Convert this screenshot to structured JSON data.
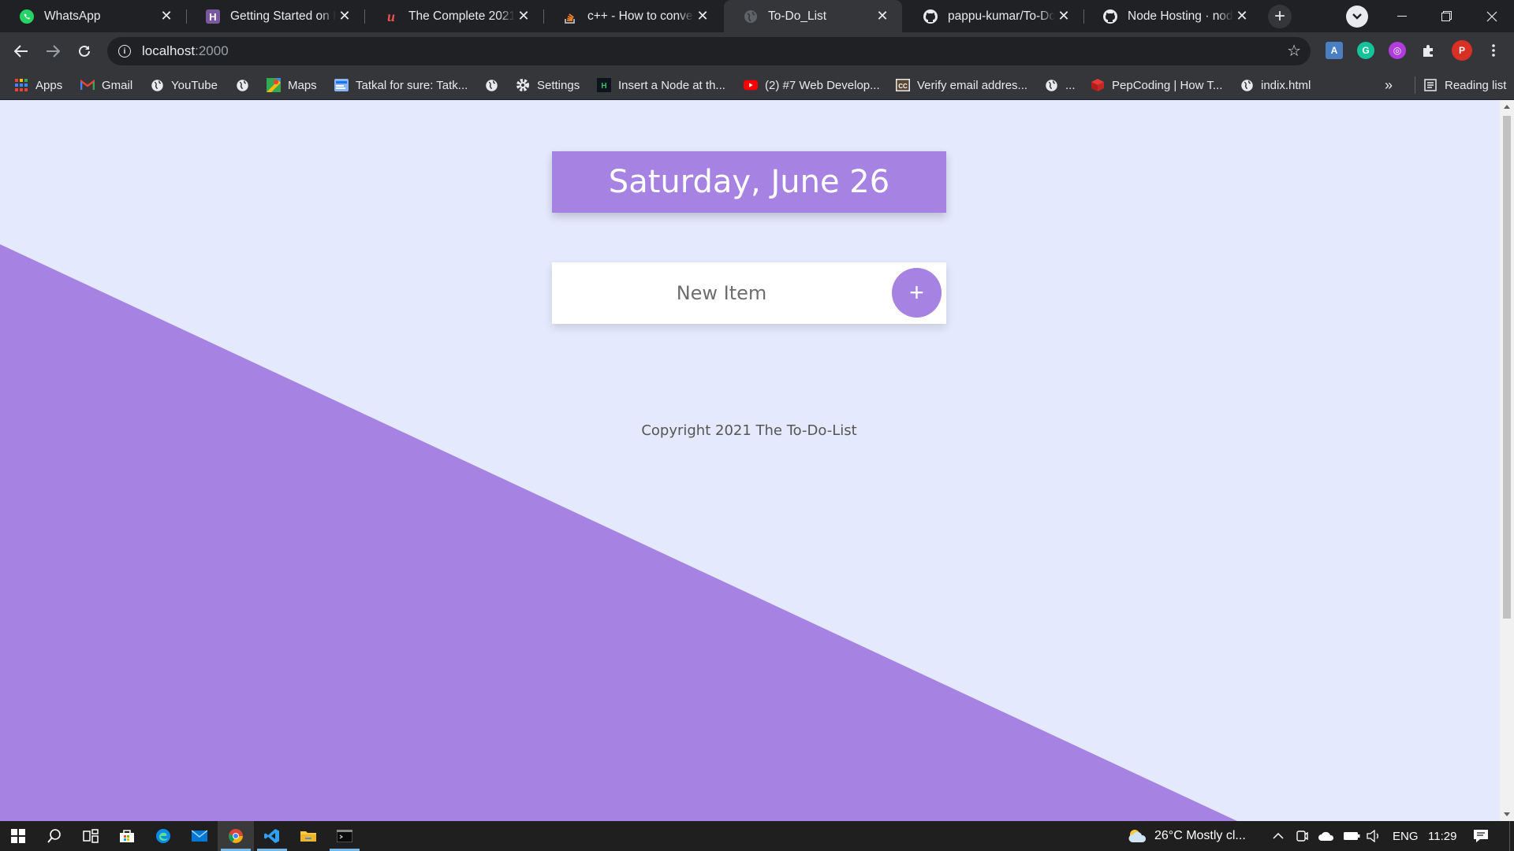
{
  "browser": {
    "tabs": [
      {
        "title": "WhatsApp",
        "icon": "whatsapp-icon",
        "active": false
      },
      {
        "title": "Getting Started on Heroku",
        "icon": "heroku-icon",
        "active": false
      },
      {
        "title": "The Complete 2021 Web",
        "icon": "udemy-icon",
        "active": false
      },
      {
        "title": "c++ - How to convert",
        "icon": "stackoverflow-icon",
        "active": false
      },
      {
        "title": "To-Do_List",
        "icon": "globe-icon",
        "active": true
      },
      {
        "title": "pappu-kumar/To-Do-List",
        "icon": "github-icon",
        "active": false
      },
      {
        "title": "Node Hosting · nodejs",
        "icon": "github-icon",
        "active": false
      }
    ],
    "url_host": "localhost",
    "url_port": ":2000",
    "profile_initial": "P",
    "bookmarks": [
      {
        "label": "Apps",
        "icon": "apps-grid-icon"
      },
      {
        "label": "Gmail",
        "icon": "gmail-icon"
      },
      {
        "label": "YouTube",
        "icon": "globe-icon"
      },
      {
        "label": "",
        "icon": "globe-icon"
      },
      {
        "label": "Maps",
        "icon": "maps-icon"
      },
      {
        "label": "Tatkal for sure: Tatk...",
        "icon": "tatkal-icon"
      },
      {
        "label": "",
        "icon": "globe-icon"
      },
      {
        "label": "Settings",
        "icon": "gear-icon"
      },
      {
        "label": "Insert a Node at th...",
        "icon": "hackerrank-icon"
      },
      {
        "label": "(2) #7 Web Develop...",
        "icon": "youtube-icon"
      },
      {
        "label": "Verify email addres...",
        "icon": "cc-icon"
      },
      {
        "label": "...",
        "icon": "globe-icon"
      },
      {
        "label": "PepCoding | How T...",
        "icon": "pepcoding-icon"
      },
      {
        "label": "indix.html",
        "icon": "globe-icon"
      }
    ],
    "overflow_label": "»",
    "reading_list_label": "Reading list"
  },
  "page": {
    "heading": "Saturday, June 26",
    "new_item_placeholder": "New Item",
    "add_button_label": "+",
    "footer": "Copyright 2021 The To-Do-List",
    "colors": {
      "accent": "#a683e3",
      "background": "#e4e9fd"
    }
  },
  "taskbar": {
    "weather": "26°C  Mostly cl...",
    "language": "ENG",
    "time": "11:29"
  }
}
